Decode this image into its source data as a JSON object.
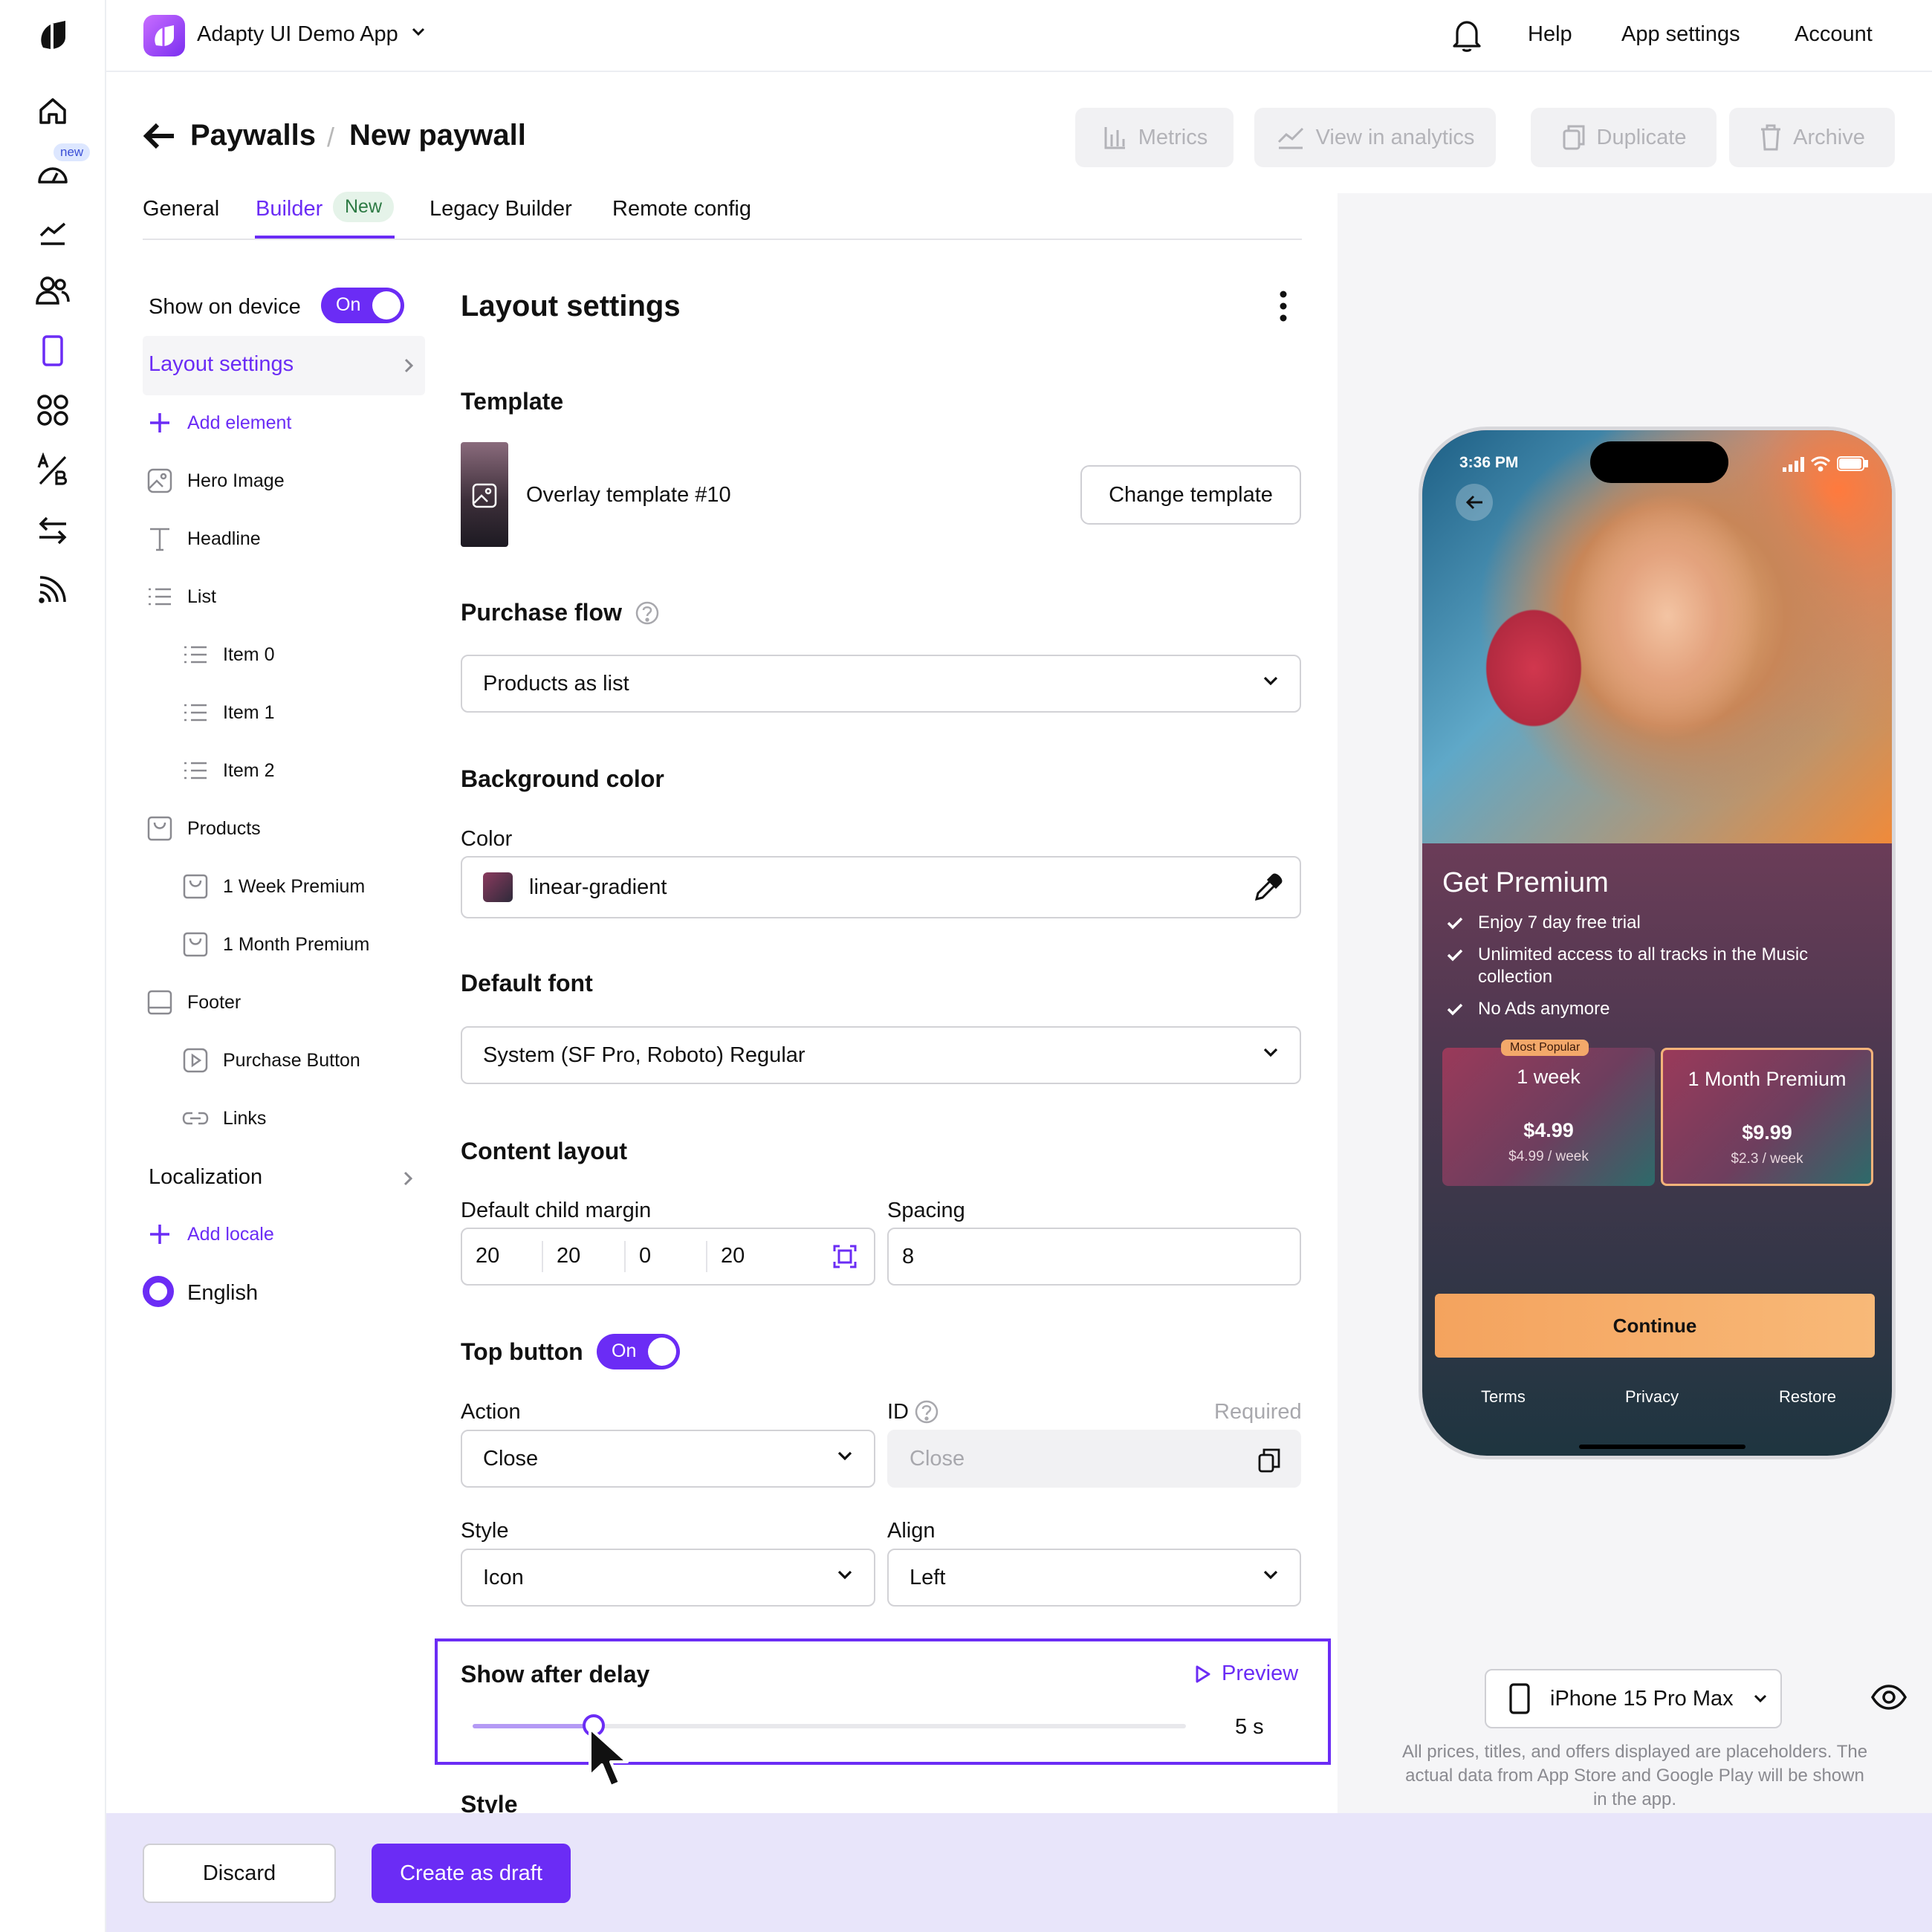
{
  "app": {
    "name": "Adapty UI Demo App"
  },
  "rail": {
    "badge": "new"
  },
  "topnav": {
    "help": "Help",
    "app_settings": "App settings",
    "account": "Account"
  },
  "header": {
    "crumb_parent": "Paywalls",
    "crumb_sep": "/",
    "crumb_current": "New paywall",
    "actions": {
      "metrics": "Metrics",
      "analytics": "View in analytics",
      "duplicate": "Duplicate",
      "archive": "Archive"
    }
  },
  "tabs": {
    "general": "General",
    "builder": "Builder",
    "builder_badge": "New",
    "legacy": "Legacy Builder",
    "remote": "Remote config"
  },
  "sidebar": {
    "show_on_device": "Show on device",
    "toggle_on": "On",
    "layout_settings": "Layout settings",
    "add_element": "Add element",
    "items": {
      "hero": "Hero Image",
      "headline": "Headline",
      "list": "List",
      "item0": "Item 0",
      "item1": "Item 1",
      "item2": "Item 2",
      "products": "Products",
      "week": "1 Week Premium",
      "month": "1 Month Premium",
      "footer": "Footer",
      "purchase": "Purchase Button",
      "links": "Links"
    },
    "localization": "Localization",
    "add_locale": "Add locale",
    "locale": "English"
  },
  "main": {
    "title": "Layout settings",
    "template": {
      "title": "Template",
      "name": "Overlay template #10",
      "change": "Change template"
    },
    "purchase_flow": {
      "title": "Purchase flow",
      "value": "Products as list"
    },
    "background": {
      "title": "Background color",
      "color_label": "Color",
      "value": "linear-gradient"
    },
    "font": {
      "title": "Default font",
      "value": "System (SF Pro, Roboto) Regular"
    },
    "content_layout": {
      "title": "Content layout",
      "margin_label": "Default child margin",
      "margins": [
        "20",
        "20",
        "0",
        "20"
      ],
      "spacing_label": "Spacing",
      "spacing": "8"
    },
    "top_button": {
      "title": "Top button",
      "toggle": "On",
      "action_label": "Action",
      "action": "Close",
      "id_label": "ID",
      "required": "Required",
      "id_placeholder": "Close",
      "style_label": "Style",
      "style": "Icon",
      "align_label": "Align",
      "align": "Left"
    },
    "delay": {
      "title": "Show after delay",
      "preview": "Preview",
      "value": "5 s",
      "slider_fraction": 0.17
    },
    "next_section": "Style"
  },
  "preview": {
    "time": "3:36 PM",
    "title": "Get Premium",
    "features": [
      "Enjoy 7 day free trial",
      "Unlimited access to all tracks in the Music collection",
      "No Ads anymore"
    ],
    "badge": "Most Popular",
    "products": [
      {
        "name": "1 week",
        "price": "$4.99",
        "per": "$4.99 / week"
      },
      {
        "name": "1 Month Premium",
        "price": "$9.99",
        "per": "$2.3 / week"
      }
    ],
    "continue": "Continue",
    "links": [
      "Terms",
      "Privacy",
      "Restore"
    ]
  },
  "device": {
    "name": "iPhone 15 Pro Max"
  },
  "disclaimer": "All prices, titles, and offers displayed are placeholders. The actual data from App Store and Google Play will be shown in the app.",
  "footer_actions": {
    "discard": "Discard",
    "create": "Create as draft"
  },
  "colors": {
    "accent": "#6b2cf5",
    "continue": "#f4a35e"
  }
}
